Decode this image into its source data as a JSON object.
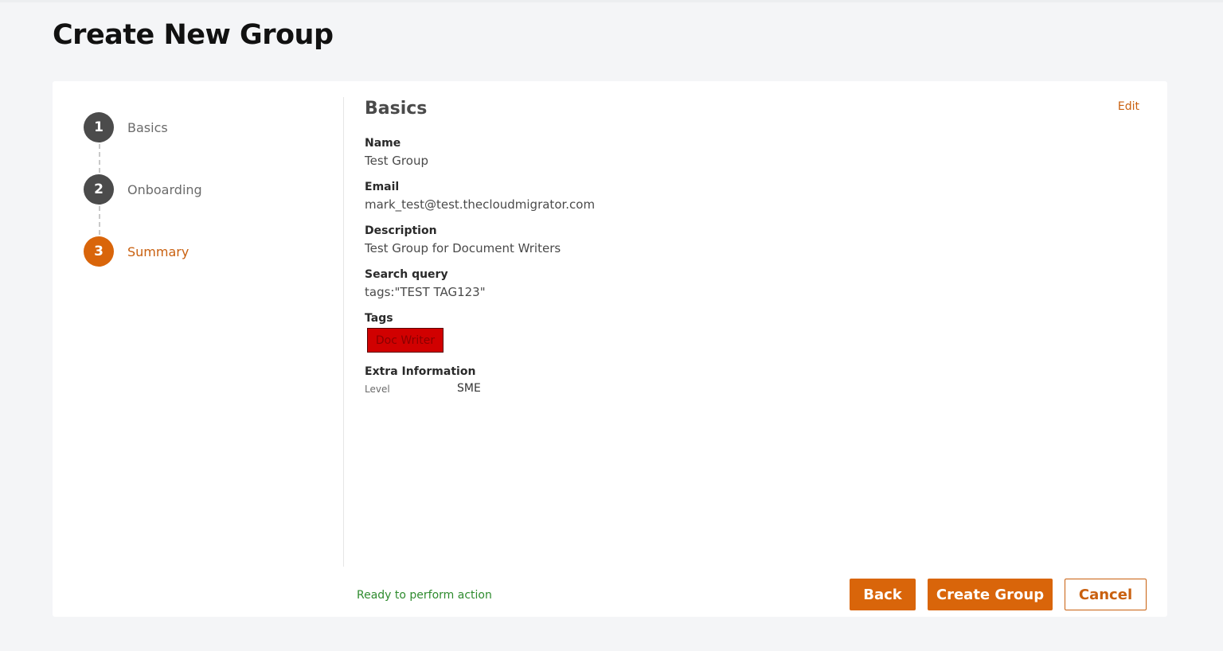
{
  "page": {
    "title": "Create New Group"
  },
  "stepper": {
    "steps": [
      {
        "number": "1",
        "label": "Basics",
        "state": "done"
      },
      {
        "number": "2",
        "label": "Onboarding",
        "state": "done"
      },
      {
        "number": "3",
        "label": "Summary",
        "state": "active"
      }
    ]
  },
  "summary": {
    "section_title": "Basics",
    "edit_label": "Edit",
    "fields": {
      "name": {
        "label": "Name",
        "value": "Test Group"
      },
      "email": {
        "label": "Email",
        "value": "mark_test@test.thecloudmigrator.com"
      },
      "description": {
        "label": "Description",
        "value": "Test Group for Document Writers"
      },
      "search_query": {
        "label": "Search query",
        "value": "tags:\"TEST TAG123\""
      },
      "tags": {
        "label": "Tags",
        "items": [
          {
            "text": "Doc Writer",
            "color": "#d10000"
          }
        ]
      },
      "extra": {
        "label": "Extra Information",
        "key": "Level",
        "value": "SME"
      }
    }
  },
  "footer": {
    "status": "Ready to perform action",
    "back_label": "Back",
    "create_label": "Create Group",
    "cancel_label": "Cancel"
  },
  "colors": {
    "accent": "#d9650a",
    "step_done": "#4b4b4b",
    "status_ok": "#2e8b2e",
    "background": "#f4f5f7"
  }
}
